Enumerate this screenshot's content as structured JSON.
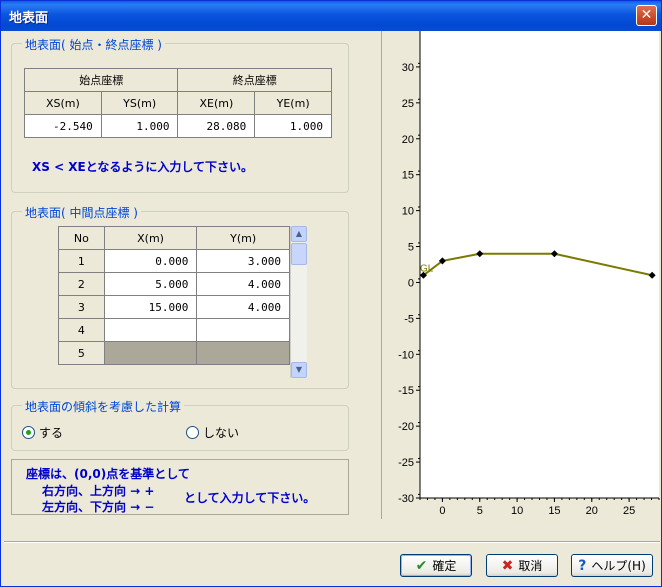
{
  "window": {
    "title": "地表面",
    "close_glyph": "✕"
  },
  "endpoints": {
    "group_title": "地表面( 始点・終点座標 )",
    "start_header": "始点座標",
    "end_header": "終点座標",
    "columns": [
      "XS(m)",
      "YS(m)",
      "XE(m)",
      "YE(m)"
    ],
    "values": [
      "-2.540",
      "1.000",
      "28.080",
      "1.000"
    ],
    "note": "XS < XEとなるように入力して下さい。"
  },
  "midpoints": {
    "group_title": "地表面( 中間点座標 )",
    "columns": [
      "No",
      "X(m)",
      "Y(m)"
    ],
    "rows": [
      {
        "no": "1",
        "x": "0.000",
        "y": "3.000"
      },
      {
        "no": "2",
        "x": "5.000",
        "y": "4.000"
      },
      {
        "no": "3",
        "x": "15.000",
        "y": "4.000"
      },
      {
        "no": "4",
        "x": "",
        "y": ""
      },
      {
        "no": "5",
        "x": "",
        "y": ""
      }
    ]
  },
  "slope": {
    "group_title": "地表面の傾斜を考慮した計算",
    "option_yes": "する",
    "option_no": "しない",
    "selected": "yes"
  },
  "info": {
    "line1": "座標は、(0,0)点を基準として",
    "line2": "右方向、上方向 → +",
    "line3": "左方向、下方向 → −",
    "line4": "として入力して下さい。"
  },
  "buttons": {
    "ok": "確定",
    "cancel": "取消",
    "help": "ヘルプ(H)"
  },
  "chart_data": {
    "type": "line",
    "title": "",
    "xlabel": "",
    "ylabel": "",
    "xlim": [
      -3,
      29
    ],
    "ylim": [
      -30,
      35
    ],
    "x_ticks": [
      0,
      5,
      10,
      15,
      20,
      25
    ],
    "y_ticks": [
      30,
      25,
      20,
      15,
      10,
      5,
      0,
      -5,
      -10,
      -15,
      -20,
      -25,
      -30
    ],
    "grid": false,
    "annotation": "GL",
    "series": [
      {
        "x": [
          -2.54,
          0,
          5,
          15,
          28.08
        ],
        "y": [
          1.0,
          3.0,
          4.0,
          4.0,
          1.0
        ],
        "color": "#7a7a00"
      }
    ]
  }
}
